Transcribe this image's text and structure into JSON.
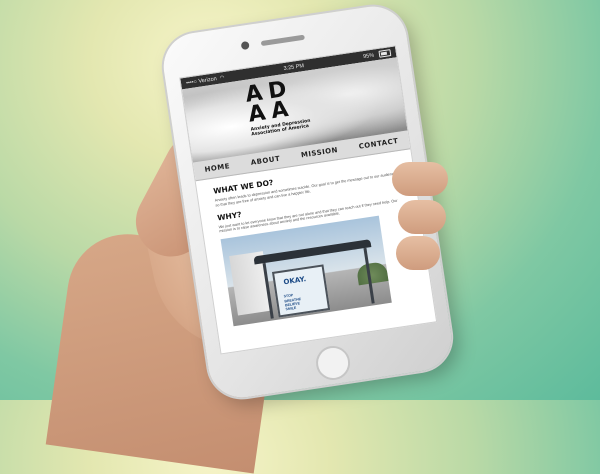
{
  "status_bar": {
    "carrier": "••••○ Verizon",
    "time": "3:25 PM",
    "battery": "95%"
  },
  "site": {
    "logo_line1": "AD",
    "logo_line2": "AA",
    "logo_tagline": "Anxiety and Depression Association of America"
  },
  "nav": {
    "items": [
      "HOME",
      "ABOUT",
      "MISSION",
      "CONTACT"
    ]
  },
  "content": {
    "section1_heading": "WHAT WE DO?",
    "section1_body": "Anxiety often leads to depression and sometimes suicide. Our goal is to get the message out to our audience so that they are free of anxiety and can live a happier life.",
    "section2_heading": "WHY?",
    "section2_body": "We just want to let everyone know that they are not alone and that they can reach out if they need help. Our mission is to raise awareness about anxiety and the resources available.",
    "photo_billboard_title": "OKAY.",
    "photo_billboard_lines": [
      "STOP",
      "BREATHE",
      "BELIEVE",
      "SMILE"
    ]
  },
  "colors": {
    "background_light": "#f6f4c8",
    "background_dark": "#5dbb9c",
    "nav_bar": "#dcdcdc",
    "status_bar": "#2f2f2f",
    "billboard_text": "#1d4b86"
  },
  "icons": [
    "wifi-icon",
    "battery-icon",
    "home-button"
  ]
}
